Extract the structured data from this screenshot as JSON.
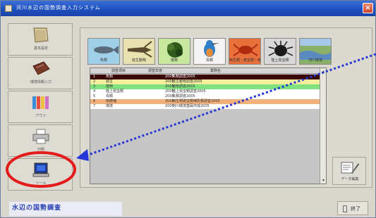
{
  "window": {
    "title": "河川水辺の国勢調査入力システム",
    "close_label": "×"
  },
  "sidebar": {
    "items": [
      {
        "label": "基本設定",
        "icon": "book-icon"
      },
      {
        "label": "環境情報入力",
        "icon": "notebook-icon"
      },
      {
        "label": "アウト",
        "icon": "binders-icon"
      },
      {
        "label": "印刷",
        "icon": "printer-icon"
      },
      {
        "label": "ツール",
        "icon": "computer-icon"
      }
    ]
  },
  "categories": [
    {
      "label": "魚類",
      "icon": "fish-icon"
    },
    {
      "label": "底生動物",
      "icon": "crayfish-icon"
    },
    {
      "label": "植物",
      "icon": "plant-icon"
    },
    {
      "label": "鳥類",
      "icon": "kingfisher-icon"
    },
    {
      "label": "両生類・爬虫類・哺乳類",
      "icon": "crab-icon"
    },
    {
      "label": "陸上昆虫類",
      "icon": "beetle-icon"
    },
    {
      "label": "河川環境",
      "icon": "river-scene-icon"
    }
  ],
  "table": {
    "headers": [
      "調査項目",
      "調査年度",
      "業務名"
    ],
    "rows": [
      {
        "num": "1",
        "item": "魚類",
        "year": "2005",
        "name": "魚類調査2005",
        "bg": "#3a0606",
        "fg": "#ffffff"
      },
      {
        "num": "2",
        "item": "底生",
        "year": "2005",
        "name": "底生動物調査2005",
        "bg": "#f2ee9e",
        "fg": "#333333"
      },
      {
        "num": "3",
        "item": "植物",
        "year": "2005",
        "name": "植物調査2005",
        "bg": "#7fe27f",
        "fg": "#333333"
      },
      {
        "num": "4",
        "item": "陸上昆虫類",
        "year": "2005",
        "name": "陸上昆虫類調査2005",
        "bg": "#ffffff",
        "fg": "#333333"
      },
      {
        "num": "5",
        "item": "鳥類",
        "year": "2005",
        "name": "鳥類調査2005",
        "bg": "#ffffff",
        "fg": "#333333"
      },
      {
        "num": "6",
        "item": "両爬哺",
        "year": "2005",
        "name": "両生類爬虫類哺乳類調査2005",
        "bg": "#f2b07a",
        "fg": "#333333"
      },
      {
        "num": "7",
        "item": "環境",
        "year": "2005",
        "name": "河川環境基図作成2005",
        "bg": "#ffffff",
        "fg": "#333333"
      }
    ]
  },
  "data_button": {
    "label": "データ編集",
    "icon": "edit-document-icon"
  },
  "status": {
    "banner": "水辺の国勢調査"
  },
  "exit_button": {
    "label": "終了"
  },
  "annotation": {
    "highlight_color": "#e31b1b",
    "arrow_color": "#2436d6"
  },
  "colors": {
    "titlebar": "#1d4fbf",
    "panel": "#dcd9d0",
    "grid_bg": "#c6c6c6"
  }
}
